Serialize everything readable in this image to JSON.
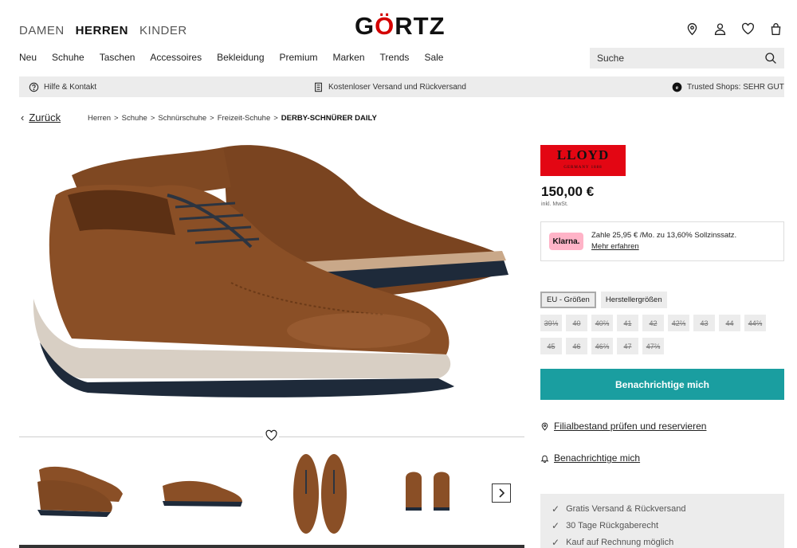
{
  "header": {
    "gender_tabs": [
      "DAMEN",
      "HERREN",
      "KINDER"
    ],
    "logo_prefix": "G",
    "logo_mark": "Ö",
    "logo_suffix": "RTZ",
    "icons": [
      "location-icon",
      "user-icon",
      "heart-icon",
      "bag-icon"
    ]
  },
  "nav": {
    "items": [
      "Neu",
      "Schuhe",
      "Taschen",
      "Accessoires",
      "Bekleidung",
      "Premium",
      "Marken",
      "Trends",
      "Sale"
    ]
  },
  "search": {
    "placeholder": "Suche"
  },
  "infobar": {
    "help": "Hilfe & Kontakt",
    "shipping": "Kostenloser Versand und Rückversand",
    "trusted": "Trusted Shops: SEHR GUT"
  },
  "breadcrumb": {
    "back": "Zurück",
    "items": [
      "Herren",
      "Schuhe",
      "Schnürschuhe",
      "Freizeit-Schuhe"
    ],
    "current": "DERBY-SCHNÜRER DAILY",
    "separator": ">"
  },
  "product": {
    "brand_name": "LLOYD",
    "brand_sub": "GERMANY 1888",
    "price": "150,00 €",
    "vat": "inkl. MwSt.",
    "klarna_badge": "Klarna.",
    "klarna_text": "Zahle 25,95 € /Mo. zu 13,60% Sollzinssatz.",
    "klarna_link": "Mehr erfahren",
    "size_tabs": [
      "EU - Größen",
      "Herstellergrößen"
    ],
    "sizes_row1": [
      "39⅓",
      "40",
      "40⅔",
      "41",
      "42",
      "42⅔",
      "43",
      "44",
      "44⅔"
    ],
    "sizes_row2": [
      "45",
      "46",
      "46⅔",
      "47",
      "47⅔"
    ],
    "cta": "Benachrichtige mich",
    "store_link": "Filialbestand prüfen und reservieren",
    "notify_link": "Benachrichtige mich",
    "benefits": [
      "Gratis Versand & Rückversand",
      "30 Tage Rückgaberecht",
      "Kauf auf Rechnung möglich"
    ]
  },
  "colors": {
    "accent": "#1a9ea0",
    "brand_red": "#e30613",
    "klarna_pink": "#ffb3c7",
    "shoe_brown": "#8a4f26",
    "gray_bg": "#ececec"
  }
}
